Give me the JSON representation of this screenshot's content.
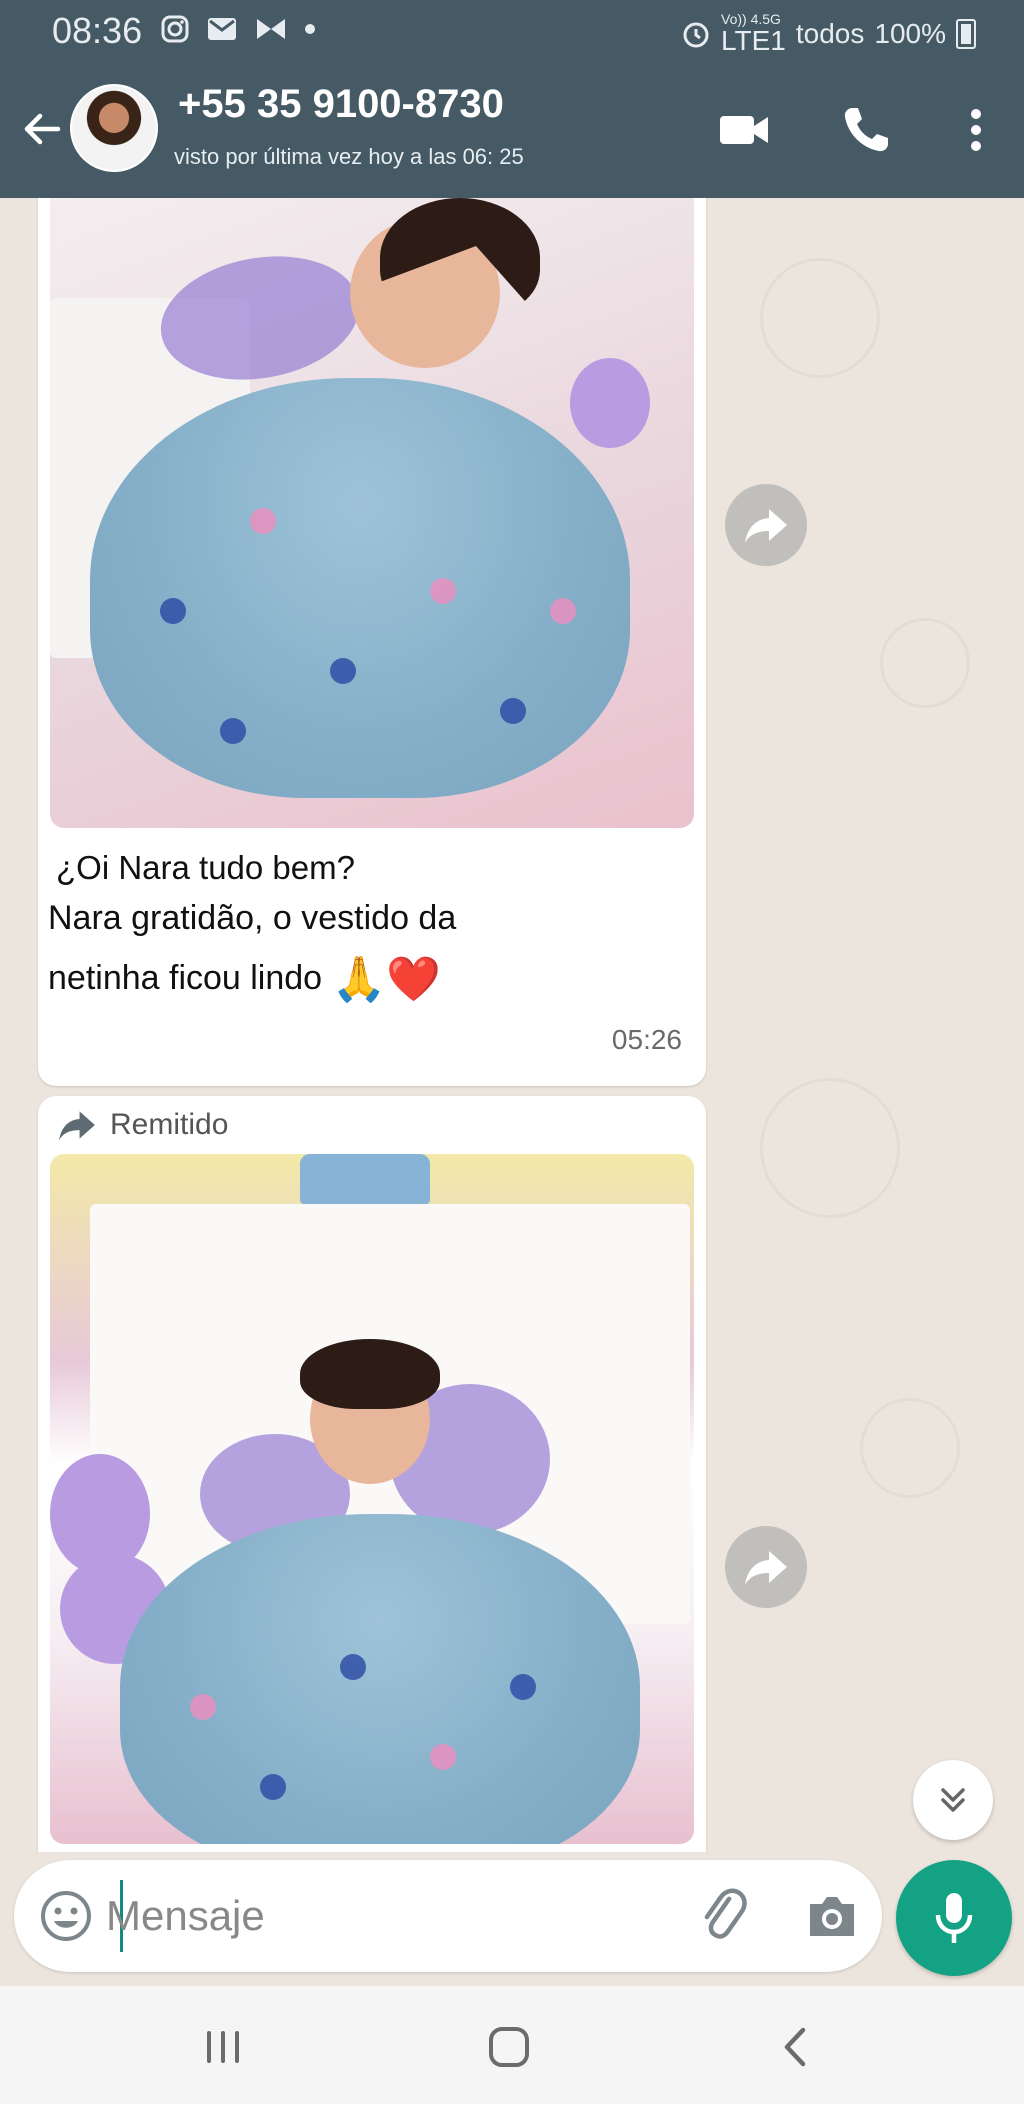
{
  "status_bar": {
    "time": "08:36",
    "network_top": "Vo)) 4.5G",
    "network_bottom": "LTE1",
    "carrier": "todos",
    "battery": "100%",
    "icons": [
      "instagram-icon",
      "gmail-icon",
      "butterfly-icon",
      "dot-icon",
      "alarm-icon",
      "battery-icon"
    ]
  },
  "header": {
    "contact_name": "+55 35 9100-8730",
    "last_seen": "visto por última vez hoy a las 06: 25"
  },
  "messages": [
    {
      "type": "image_with_caption",
      "caption_line1": "¿Oi Nara tudo bem?",
      "caption_line2": "Nara gratidão, o vestido da",
      "caption_line3": "netinha ficou lindo",
      "caption_emojis": "🙏❤️",
      "time": "05:26"
    },
    {
      "type": "forwarded_image",
      "forwarded_label": "Remitido"
    }
  ],
  "composer": {
    "placeholder": "Mensaje"
  },
  "colors": {
    "header": "#455a64",
    "chat_background": "#ece5dd",
    "accent": "#13a384"
  }
}
